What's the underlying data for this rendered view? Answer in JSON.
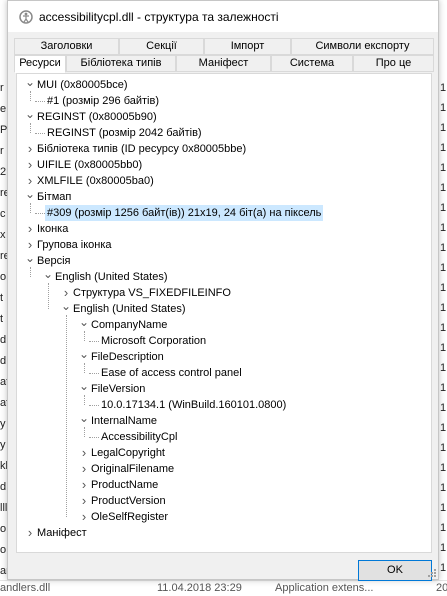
{
  "window": {
    "title": "accessibilitycpl.dll - структура та залежності",
    "ok_label": "OK"
  },
  "tabs_back": [
    "Заголовки",
    "Секції",
    "Імпорт",
    "Символи експорту"
  ],
  "tabs_front": [
    "Ресурси",
    "Бібліотека типів",
    "Маніфест",
    "Система",
    "Про це"
  ],
  "active_tab": "Ресурси",
  "tree": [
    {
      "level": 0,
      "label": "MUI (0x80005bce)",
      "toggle": "expanded"
    },
    {
      "level": 1,
      "label": "#1 (розмір 296 байтів)",
      "toggle": "none"
    },
    {
      "level": 0,
      "label": "REGINST (0x80005b90)",
      "toggle": "expanded"
    },
    {
      "level": 1,
      "label": "REGINST (розмір 2042 байтів)",
      "toggle": "none"
    },
    {
      "level": 0,
      "label": "Бібліотека типів (ID ресурсу 0x80005bbe)",
      "toggle": "collapsed"
    },
    {
      "level": 0,
      "label": "UIFILE (0x80005bb0)",
      "toggle": "collapsed"
    },
    {
      "level": 0,
      "label": "XMLFILE (0x80005ba0)",
      "toggle": "collapsed"
    },
    {
      "level": 0,
      "label": "Бітмап",
      "toggle": "expanded"
    },
    {
      "level": 1,
      "label": "#309 (розмір 1256 байт(ів)) 21x19, 24 біт(а) на піксель",
      "toggle": "none",
      "selected": true
    },
    {
      "level": 0,
      "label": "Іконка",
      "toggle": "collapsed"
    },
    {
      "level": 0,
      "label": "Групова іконка",
      "toggle": "collapsed"
    },
    {
      "level": 0,
      "label": "Версія",
      "toggle": "expanded"
    },
    {
      "level": 1,
      "label": "English (United States)",
      "toggle": "expanded"
    },
    {
      "level": 2,
      "label": "Структура VS_FIXEDFILEINFO",
      "toggle": "collapsed"
    },
    {
      "level": 2,
      "label": "English (United States)",
      "toggle": "expanded"
    },
    {
      "level": 3,
      "label": "CompanyName",
      "toggle": "expanded"
    },
    {
      "level": 4,
      "label": "Microsoft Corporation",
      "toggle": "none"
    },
    {
      "level": 3,
      "label": "FileDescription",
      "toggle": "expanded"
    },
    {
      "level": 4,
      "label": "Ease of access  control panel",
      "toggle": "none"
    },
    {
      "level": 3,
      "label": "FileVersion",
      "toggle": "expanded"
    },
    {
      "level": 4,
      "label": "10.0.17134.1 (WinBuild.160101.0800)",
      "toggle": "none"
    },
    {
      "level": 3,
      "label": "InternalName",
      "toggle": "expanded"
    },
    {
      "level": 4,
      "label": "AccessibilityCpl",
      "toggle": "none"
    },
    {
      "level": 3,
      "label": "LegalCopyright",
      "toggle": "collapsed"
    },
    {
      "level": 3,
      "label": "OriginalFilename",
      "toggle": "collapsed"
    },
    {
      "level": 3,
      "label": "ProductName",
      "toggle": "collapsed"
    },
    {
      "level": 3,
      "label": "ProductVersion",
      "toggle": "collapsed"
    },
    {
      "level": 3,
      "label": "OleSelfRegister",
      "toggle": "collapsed"
    },
    {
      "level": 0,
      "label": "Маніфест",
      "toggle": "collapsed"
    }
  ],
  "background": {
    "left_fragments": [
      "r",
      "e",
      "P",
      "r",
      "2",
      "re",
      "c",
      "x",
      "re",
      "o",
      "t",
      "t",
      "d",
      "d",
      "at",
      "at",
      "y",
      "y",
      "kl",
      "d",
      "lll",
      "o",
      "o",
      "ar"
    ],
    "right_fragments": [
      "1",
      "1",
      "1",
      "1",
      "1",
      "1",
      "1",
      "1",
      "1",
      "1",
      "1",
      "1",
      "1",
      "1",
      "1",
      "1",
      "1",
      "1",
      "1",
      "1",
      "1",
      "1",
      "1",
      "1",
      "1"
    ],
    "bottom_row": [
      "andlers.dll",
      "11.04.2018 23:29",
      "Application extens...",
      "20"
    ]
  },
  "colors": {
    "selection": "#cce8ff",
    "ok_border": "#0078d7",
    "dialog_bg": "#f0f0f0"
  }
}
